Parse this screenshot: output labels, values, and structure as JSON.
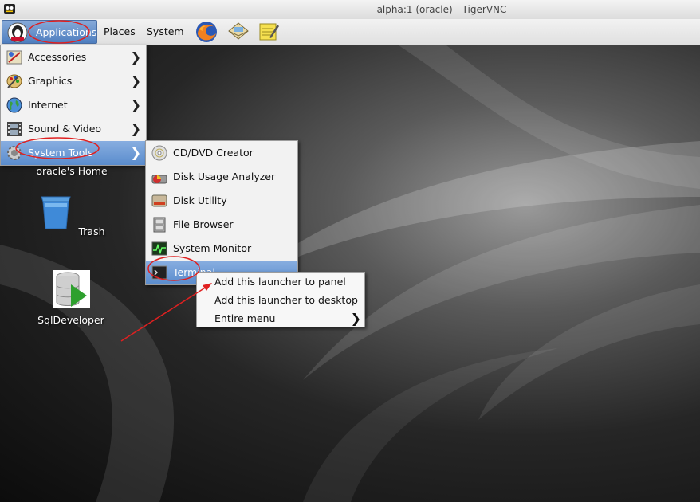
{
  "window": {
    "title": "alpha:1 (oracle) - TigerVNC",
    "icon": "tigervnc-icon"
  },
  "panel": {
    "applications_label": "Applications",
    "places_label": "Places",
    "system_label": "System",
    "launchers": [
      "firefox-icon",
      "mail-icon",
      "notes-icon"
    ]
  },
  "applications_menu": [
    {
      "label": "Accessories",
      "icon": "accessories-icon"
    },
    {
      "label": "Graphics",
      "icon": "graphics-icon"
    },
    {
      "label": "Internet",
      "icon": "internet-globe-icon"
    },
    {
      "label": "Sound & Video",
      "icon": "film-strip-icon"
    },
    {
      "label": "System Tools",
      "icon": "gear-icon",
      "selected": true
    }
  ],
  "system_tools_menu": [
    {
      "label": "CD/DVD Creator",
      "icon": "cd-icon"
    },
    {
      "label": "Disk Usage Analyzer",
      "icon": "disk-usage-icon"
    },
    {
      "label": "Disk Utility",
      "icon": "disk-icon"
    },
    {
      "label": "File Browser",
      "icon": "cabinet-icon"
    },
    {
      "label": "System Monitor",
      "icon": "monitor-icon"
    },
    {
      "label": "Terminal",
      "icon": "terminal-icon",
      "selected": true
    }
  ],
  "context_menu": [
    {
      "label": "Add this launcher to panel"
    },
    {
      "label": "Add this launcher to desktop"
    },
    {
      "label": "Entire menu",
      "submenu": true
    }
  ],
  "desktop_icons": [
    {
      "label": "oracle's Home",
      "icon": "home-folder-icon"
    },
    {
      "label": "Trash",
      "icon": "trash-icon"
    },
    {
      "label": "SqlDeveloper",
      "icon": "database-icon"
    }
  ],
  "colors": {
    "highlight": "#5a8ccd",
    "annotation": "#e02020"
  }
}
